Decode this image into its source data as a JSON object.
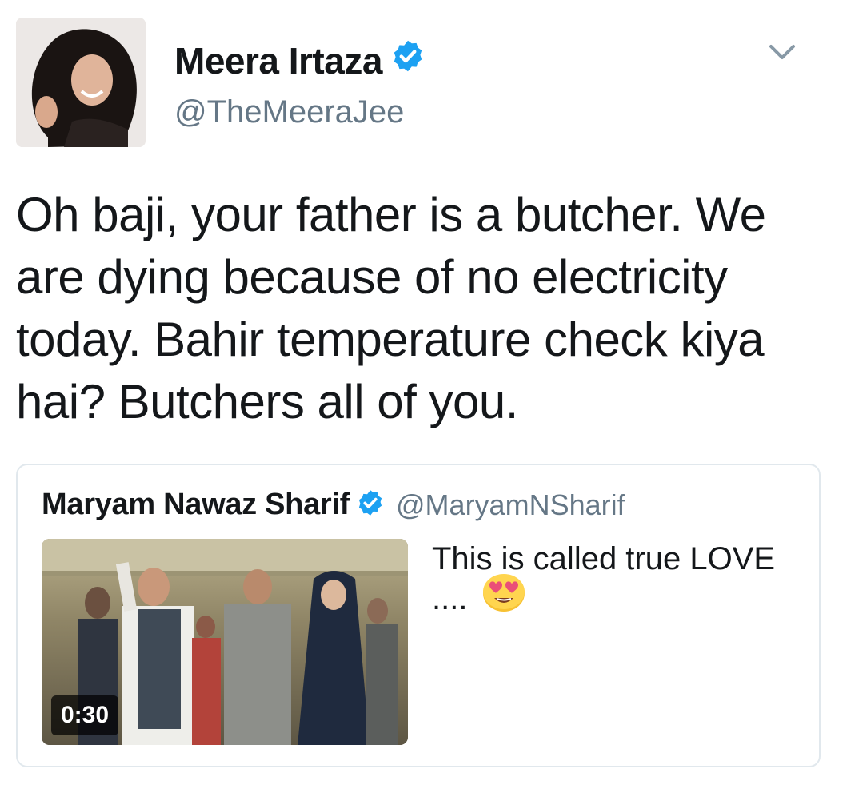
{
  "author": {
    "name": "Meera Irtaza",
    "handle": "@TheMeeraJee",
    "avatar": "avatar-photo",
    "verified_icon": "verified-badge-icon"
  },
  "tweet": {
    "text": "Oh baji, your father is a butcher. We are dying because of no electricity today. Bahir temperature check kiya hai? Butchers all of you."
  },
  "menu": {
    "caret_icon": "chevron-down-icon"
  },
  "quoted": {
    "name": "Maryam Nawaz Sharif",
    "handle": "@MaryamNSharif",
    "text": "This is called true LOVE ....",
    "emoji_icon": "smiling-face-heart-eyes-icon",
    "video": {
      "duration": "0:30",
      "thumbnail": "video-thumbnail"
    }
  },
  "colors": {
    "accent": "#1da1f2",
    "text": "#14171a",
    "secondary": "#657786",
    "border": "#e1e8ed"
  }
}
